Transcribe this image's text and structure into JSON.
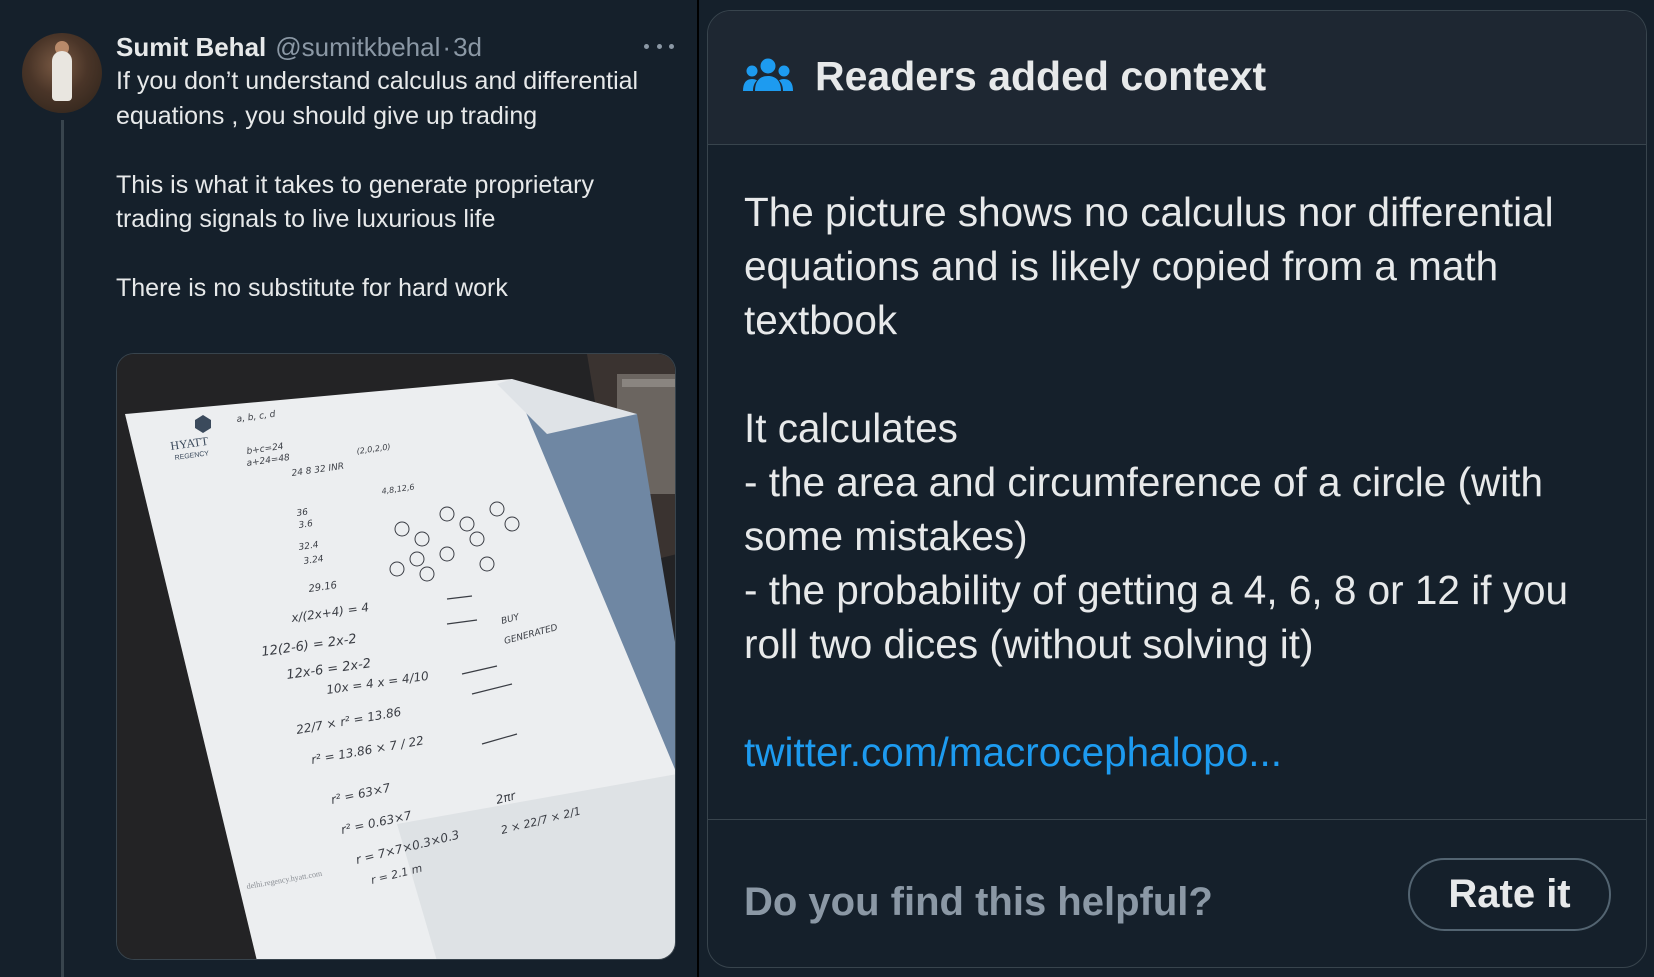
{
  "tweet": {
    "author_name": "Sumit Behal",
    "handle": "@sumitkbehal",
    "separator": "·",
    "time": "3d",
    "text_paragraphs": [
      "If you don’t understand calculus and differential equations , you should give up trading",
      "This is what it takes to generate proprietary trading signals to live luxurious life",
      "There is no substitute for hard work"
    ],
    "media": {
      "paper_logo": "HYATT",
      "paper_logo_sub": "REGENCY",
      "paper_footer": "delhi.regency.hyatt.com",
      "handwriting_lines": [
        "a, b, c, d",
        "b+c=24",
        "a+24=48",
        "24 8 32 INR",
        "(2,0,2,0)",
        "4,8,12,6",
        "36",
        "3.6",
        "32.4",
        "3.24",
        "29.16",
        "x/(2x+4) = 4",
        "12(2-6) = 2x-2",
        "12x-6 = 2x-2",
        "10x = 4   x = 4/10",
        "BUY",
        "GENERATED",
        "22/7 × r² = 13.86",
        "r² = 13.86 × 7 / 22",
        "r² = 63×7",
        "r² = 0.63×7",
        "r = 7×7×0.3×0.3",
        "r = 2.1 m",
        "2πr",
        "2 × 22/7 × 2/1"
      ]
    }
  },
  "note": {
    "title": "Readers added context",
    "icon": "people-icon",
    "paragraph1": "The picture shows no calculus nor differential equations and is likely copied from a math textbook",
    "paragraph2_intro": "It calculates",
    "bullet1": "- the area and circumference of a circle (with some mistakes)",
    "bullet2": "- the probability of getting a 4, 6, 8 or 12 if you roll two dices (without solving it)",
    "link": "twitter.com/macrocephalopo...",
    "question": "Do you find this helpful?",
    "rate_button": "Rate it"
  },
  "colors": {
    "background": "#15202b",
    "note_header": "#1e2732",
    "border": "#38444d",
    "link": "#1d9bf0",
    "muted": "#8b98a5",
    "text": "#e7e9ea"
  }
}
